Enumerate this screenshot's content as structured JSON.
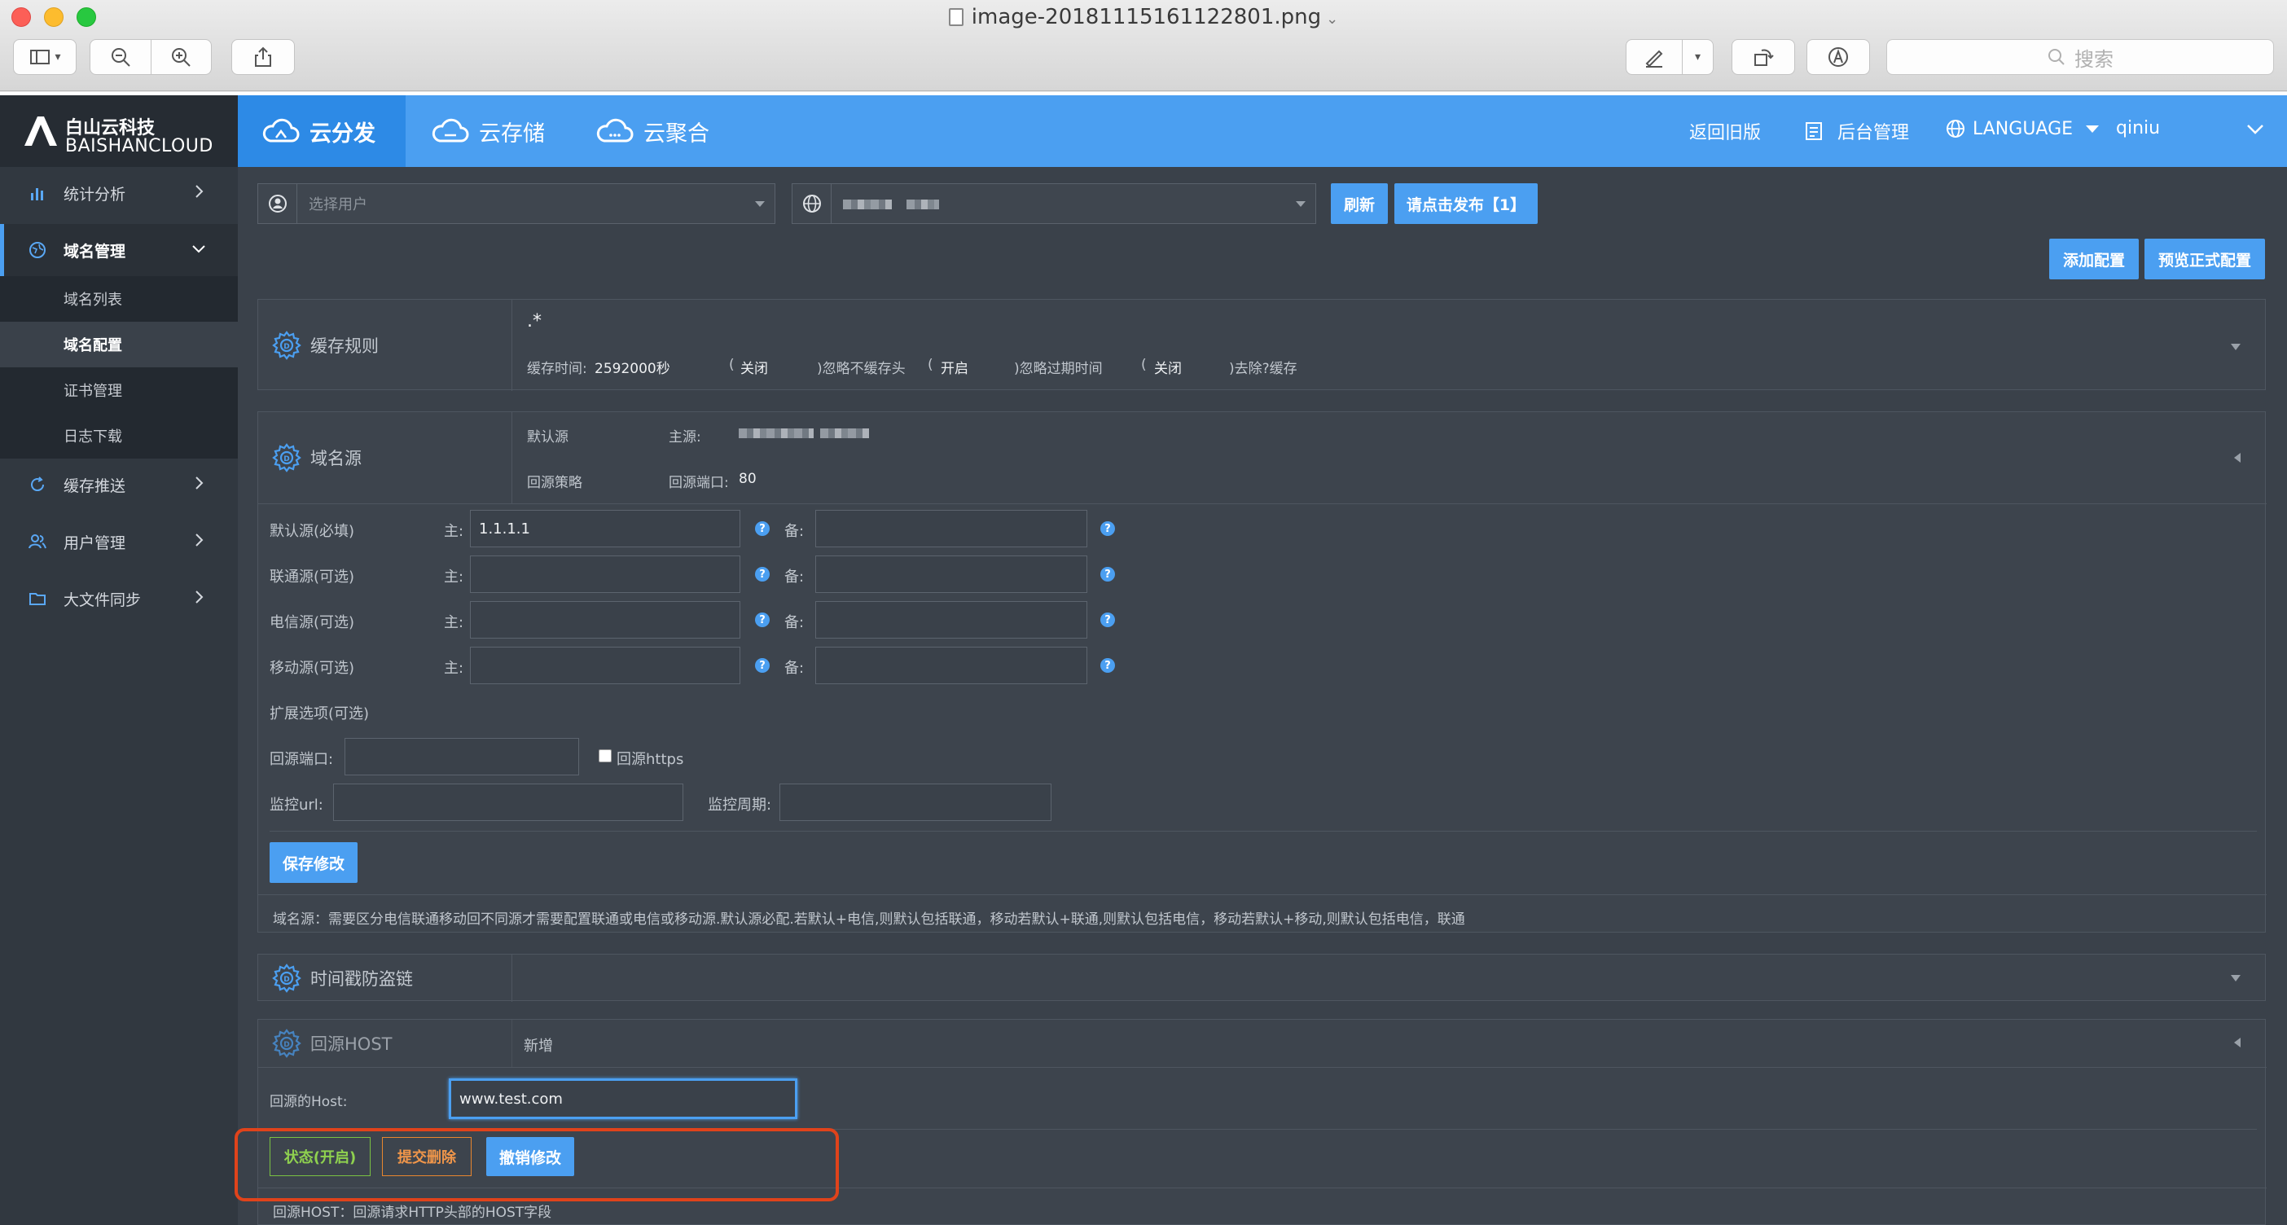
{
  "window": {
    "title": "image-20181115161122801.png",
    "search_placeholder": "搜索"
  },
  "brand": {
    "name_cn": "白山云科技",
    "name_en": "BAISHANCLOUD"
  },
  "top_nav": {
    "items": [
      "云分发",
      "云存储",
      "云聚合"
    ],
    "links": {
      "old_version": "返回旧版",
      "admin": "后台管理",
      "language": "LANGUAGE",
      "user": "qiniu"
    }
  },
  "sidebar": {
    "items": [
      "统计分析",
      "域名管理",
      "缓存推送",
      "用户管理",
      "大文件同步"
    ],
    "sub_items": [
      "域名列表",
      "域名配置",
      "证书管理",
      "日志下载"
    ]
  },
  "toolbar": {
    "user_placeholder": "选择用户",
    "refresh": "刷新",
    "publish": "请点击发布【1】",
    "add_config": "添加配置",
    "preview_config": "预览正式配置"
  },
  "cache_rule": {
    "title": "缓存规则",
    "pattern": ".*",
    "cache_time_label": "缓存时间:",
    "cache_time": "2592000秒",
    "part1_open": "(",
    "part1_val": "关闭",
    "part1_label": ")忽略不缓存头",
    "part2_open": "(",
    "part2_val": "开启",
    "part2_label": ")忽略过期时间",
    "part3_open": "(",
    "part3_val": "关闭",
    "part3_label": ")去除?缓存"
  },
  "origin": {
    "title": "域名源",
    "default_label": "默认源",
    "main_label": "主源:",
    "strategy_label": "回源策略",
    "port_label": "回源端口:",
    "port": "80",
    "rows": [
      {
        "label": "默认源(必填)",
        "main": "主:",
        "backup": "备:",
        "value": "1.1.1.1"
      },
      {
        "label": "联通源(可选)",
        "main": "主:",
        "backup": "备:",
        "value": ""
      },
      {
        "label": "电信源(可选)",
        "main": "主:",
        "backup": "备:",
        "value": ""
      },
      {
        "label": "移动源(可选)",
        "main": "主:",
        "backup": "备:",
        "value": ""
      }
    ],
    "ext_label": "扩展选项(可选)",
    "ext_port_label": "回源端口:",
    "https_label": "回源https",
    "monitor_url_label": "监控url:",
    "monitor_period_label": "监控周期:",
    "save_btn": "保存修改",
    "note": "域名源：需要区分电信联通移动回不同源才需要配置联通或电信或移动源.默认源必配.若默认+电信,则默认包括联通，移动若默认+联通,则默认包括电信，移动若默认+移动,则默认包括电信，联通"
  },
  "timestamp_panel": {
    "title": "时间戳防盗链"
  },
  "host_panel": {
    "title": "回源HOST",
    "new_label": "新增",
    "host_label": "回源的Host:",
    "host_value": "www.test.com",
    "status_btn": "状态(开启)",
    "delete_btn": "提交删除",
    "cancel_btn": "撤销修改",
    "note": "回源HOST：回源请求HTTP头部的HOST字段"
  }
}
